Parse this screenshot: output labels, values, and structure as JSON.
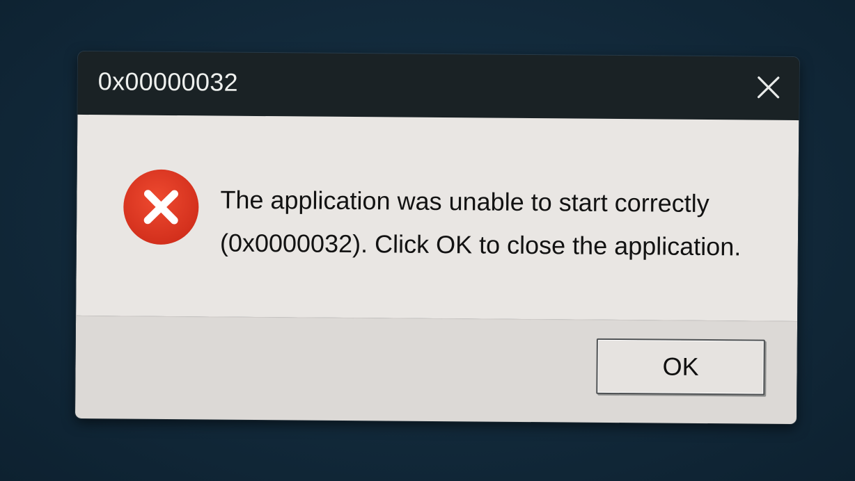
{
  "window": {
    "title": "0x00000032",
    "close_icon": "close-icon",
    "titlebar_color": "#1a2225"
  },
  "message": {
    "icon": "error-icon",
    "icon_color": "#e03b24",
    "line1": "The application was unable to start correctly",
    "line2": "(0x0000032). Click OK to close the application."
  },
  "footer": {
    "ok_label": "OK"
  },
  "colors": {
    "desktop_background": "#12293a",
    "content_background": "#e9e6e3",
    "footer_background": "#dcd9d6"
  }
}
